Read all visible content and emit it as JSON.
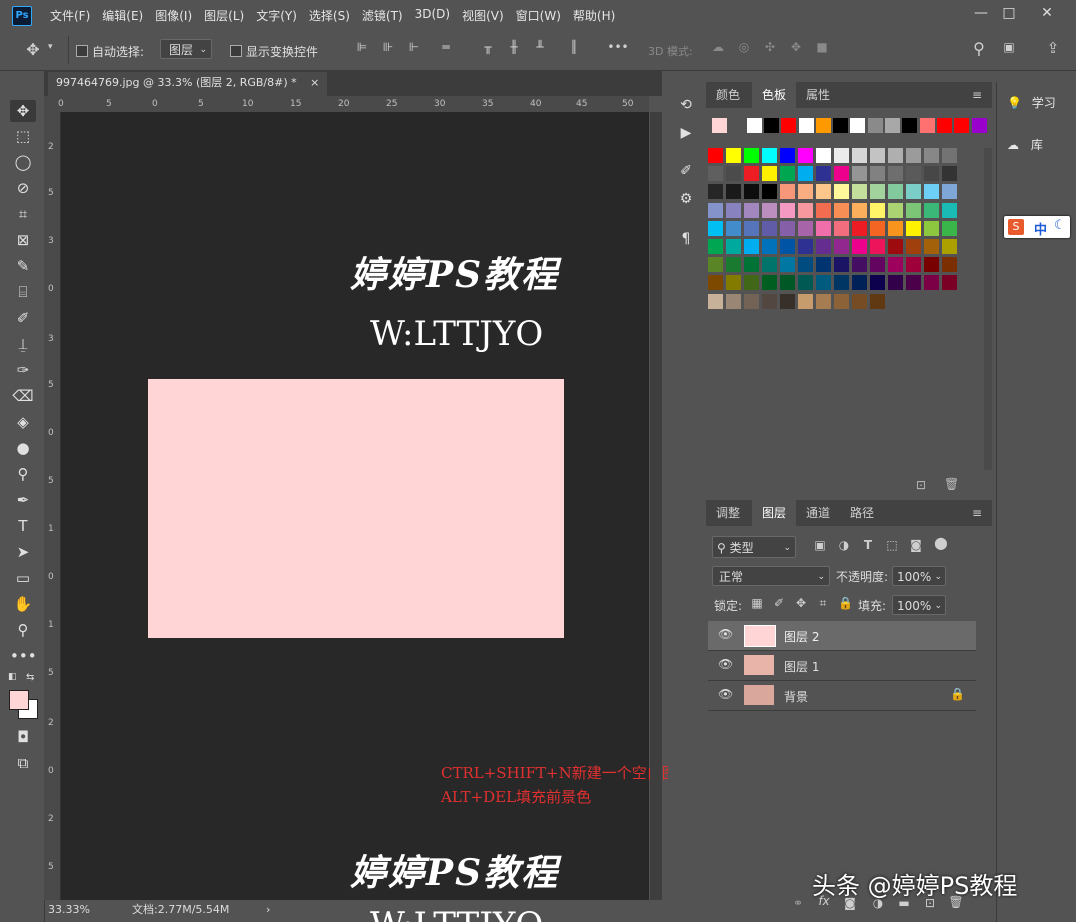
{
  "menu": {
    "logo": "Ps",
    "items": [
      "文件(F)",
      "编辑(E)",
      "图像(I)",
      "图层(L)",
      "文字(Y)",
      "选择(S)",
      "滤镜(T)",
      "3D(D)",
      "视图(V)",
      "窗口(W)",
      "帮助(H)"
    ],
    "window_buttons": [
      "—",
      "□",
      "✕"
    ]
  },
  "options": {
    "auto_select_label": "自动选择:",
    "auto_select_target": "图层",
    "show_transform_label": "显示变换控件",
    "mode_3d_label": "3D 模式:",
    "more": "•••"
  },
  "document": {
    "tab_title": "997464769.jpg @ 33.3% (图层 2, RGB/8#) *",
    "close": "×",
    "ruler_top": [
      "0",
      "5",
      "0",
      "5",
      "10",
      "15",
      "20",
      "25",
      "30",
      "35",
      "40",
      "45",
      "50"
    ],
    "ruler_left": [
      "2",
      "5",
      "3",
      "0",
      "3",
      "5",
      "0",
      "5",
      "1",
      "0",
      "1",
      "5",
      "2",
      "0",
      "2",
      "5"
    ]
  },
  "canvas": {
    "bg_color": "#282828",
    "fill_color": "#ffd5d5",
    "watermark_title": "婷婷PS教程",
    "watermark_sub": "W:LTTJYO",
    "watermark_bottom": "婷婷PS教程",
    "watermark_bottom_sub": "W:LTTJYO",
    "note_line1": "CTRL+SHIFT+N新建一个空白图层",
    "note_line2": "ALT+DEL填充前景色",
    "note_color": "#e03030"
  },
  "status": {
    "zoom": "33.33%",
    "doc_size": "文档:2.77M/5.54M",
    "arrow": "›"
  },
  "swatches_panel": {
    "tabs": [
      "颜色",
      "色板",
      "属性"
    ],
    "active_tab": "色板",
    "recent": [
      "#ffd5d5",
      "#535353",
      "#ffffff",
      "#000000",
      "#ff0000",
      "#ffffff",
      "#ff9900",
      "#000000",
      "#ffffff",
      "#8a8a8a",
      "#a8a8a8",
      "#000000",
      "#ff7070",
      "#ff0000",
      "#ff0000",
      "#9900cc"
    ],
    "grid": [
      [
        "#ff0000",
        "#ffff00",
        "#00ff00",
        "#00ffff",
        "#0000ff",
        "#ff00ff",
        "#ffffff",
        "#ebebeb",
        "#d7d7d7",
        "#c3c3c3",
        "#afafaf",
        "#9b9b9b",
        "#878787",
        "#737373"
      ],
      [
        "#5f5f5f",
        "#4b4b4b",
        "#ee1d24",
        "#fff100",
        "#00a650",
        "#00adef",
        "#2e3192",
        "#ec008c",
        "#959595",
        "#818181",
        "#6e6e6e",
        "#5a5a5a",
        "#474747",
        "#333333"
      ],
      [
        "#262626",
        "#1a1a1a",
        "#0d0d0d",
        "#000000",
        "#f7977a",
        "#f9ad81",
        "#fdc68a",
        "#fff79a",
        "#c4df9b",
        "#a3d39c",
        "#82ca9d",
        "#7bcdc8",
        "#6ecff6",
        "#7ea7d8"
      ],
      [
        "#8493ca",
        "#8882be",
        "#a187be",
        "#bc8dbf",
        "#f49ac2",
        "#f6989d",
        "#f26c4f",
        "#f68e55",
        "#fbaf5c",
        "#fff467",
        "#acd372",
        "#7cc576",
        "#3bb878",
        "#1abbb4"
      ],
      [
        "#00bff3",
        "#438ccb",
        "#5574b9",
        "#605ca8",
        "#8560a8",
        "#a864a8",
        "#f06eaa",
        "#f26d7d",
        "#ed1c24",
        "#f26522",
        "#f7941d",
        "#fff200",
        "#8dc63f",
        "#39b54a"
      ],
      [
        "#00a651",
        "#00a99d",
        "#00aeef",
        "#0072bc",
        "#0054a6",
        "#2e3192",
        "#662d91",
        "#92278f",
        "#ec008c",
        "#ed145b",
        "#9e0b0f",
        "#a0410d",
        "#a36209",
        "#aba000"
      ],
      [
        "#598527",
        "#1a7b30",
        "#007236",
        "#00746b",
        "#0076a3",
        "#004b80",
        "#003471",
        "#1b1464",
        "#440e62",
        "#630460",
        "#9e005d",
        "#9e0039",
        "#790000",
        "#7b2e00"
      ],
      [
        "#7d4900",
        "#827b00",
        "#406618",
        "#005e20",
        "#005826",
        "#005952",
        "#005b7f",
        "#003663",
        "#002157",
        "#0d004c",
        "#32004b",
        "#4b0049",
        "#7b0046",
        "#7a0026"
      ],
      [
        "#c7b299",
        "#998675",
        "#736357",
        "#534741",
        "#37302a",
        "#c69c6d",
        "#a67c52",
        "#8c6239",
        "#754c24",
        "#603913"
      ]
    ]
  },
  "layers_panel": {
    "tabs": [
      "调整",
      "图层",
      "通道",
      "路径"
    ],
    "active_tab": "图层",
    "filter_kind": "类型",
    "blend_mode": "正常",
    "opacity_label": "不透明度:",
    "opacity_value": "100%",
    "lock_label": "锁定:",
    "fill_label": "填充:",
    "fill_value": "100%",
    "layers": [
      {
        "name": "图层 2",
        "selected": true,
        "thumb": "#ffd5d5",
        "locked": false
      },
      {
        "name": "图层 1",
        "selected": false,
        "thumb": "#e8b3a8",
        "locked": false
      },
      {
        "name": "背景",
        "selected": false,
        "thumb": "#d9a79c",
        "locked": true
      }
    ]
  },
  "right_dock": {
    "learn": "学习",
    "libraries": "库"
  },
  "ime": {
    "mode": "中"
  },
  "credit": "头条 @婷婷PS教程"
}
